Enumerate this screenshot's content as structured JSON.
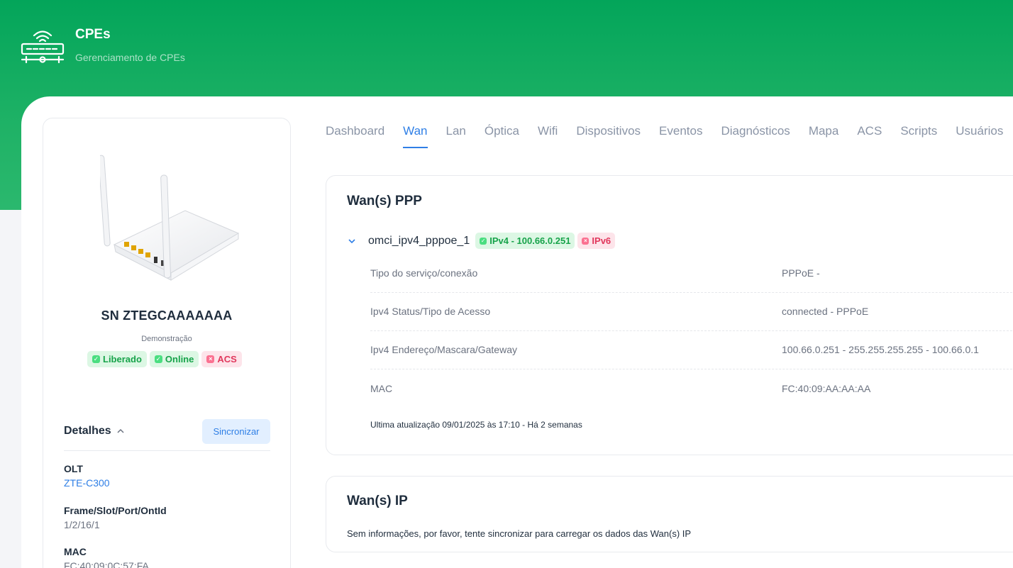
{
  "brand": {
    "title": "CPEs",
    "subtitle": "Gerenciamento de CPEs",
    "icon": "router-icon"
  },
  "device": {
    "serial": "SN ZTEGCAAAAAAA",
    "mode": "Demonstração",
    "badges": [
      {
        "label": "Liberado",
        "status": "ok"
      },
      {
        "label": "Online",
        "status": "ok"
      },
      {
        "label": "ACS",
        "status": "error"
      }
    ]
  },
  "details": {
    "title": "Detalhes",
    "sync_label": "Sincronizar",
    "items": [
      {
        "label": "OLT",
        "value": "ZTE-C300"
      },
      {
        "label": "Frame/Slot/Port/OntId",
        "value": "1/2/16/1"
      },
      {
        "label": "MAC",
        "value": "FC:40:09:0C:57:FA"
      }
    ]
  },
  "tabs": [
    "Dashboard",
    "Wan",
    "Lan",
    "Óptica",
    "Wifi",
    "Dispositivos",
    "Eventos",
    "Diagnósticos",
    "Mapa",
    "ACS",
    "Scripts",
    "Usuários"
  ],
  "active_tab": "Wan",
  "wan_ppp": {
    "title": "Wan(s) PPP",
    "connection": {
      "name": "omci_ipv4_pppoe_1",
      "ipv4_badge": "IPv4 - 100.66.0.251",
      "ipv6_badge": "IPv6"
    },
    "rows": [
      {
        "key": "Tipo do serviço/conexão",
        "value": "PPPoE -"
      },
      {
        "key": "Ipv4 Status/Tipo de Acesso",
        "value": "connected - PPPoE"
      },
      {
        "key": "Ipv4 Endereço/Mascara/Gateway",
        "value": "100.66.0.251 - 255.255.255.255 - 100.66.0.1"
      },
      {
        "key": "MAC",
        "value": "FC:40:09:AA:AA:AA"
      }
    ],
    "updated": "Ultima atualização 09/01/2025 às 17:10 - Há 2 semanas"
  },
  "wan_ip": {
    "title": "Wan(s) IP",
    "empty_message": "Sem informações, por favor, tente sincronizar para carregar os dados das Wan(s) IP"
  },
  "colors": {
    "brand_green": "#03a55a",
    "accent_blue": "#2f7fe6",
    "ok_green": "#17a34a",
    "error_red": "#e1375c"
  }
}
